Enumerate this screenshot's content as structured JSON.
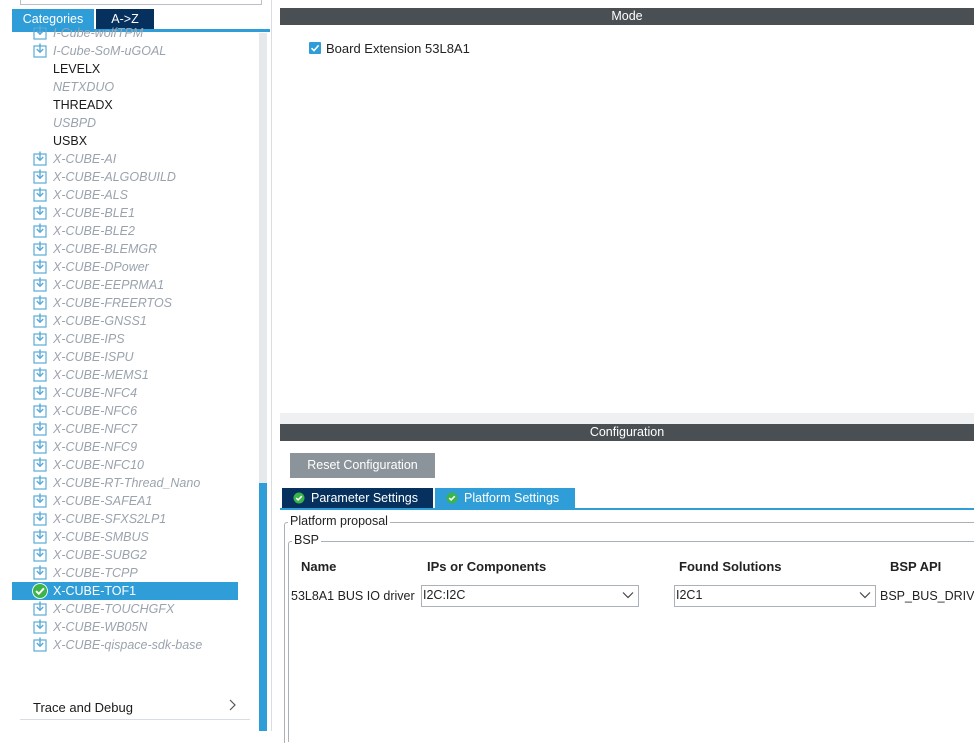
{
  "left_panel": {
    "tabs": {
      "categories": "Categories",
      "az": "A->Z"
    },
    "items": [
      {
        "label": "I-Cube-wolfTPM",
        "style": "grey",
        "icon": "download-icon"
      },
      {
        "label": "I-Cube-SoM-uGOAL",
        "style": "grey",
        "icon": "download-icon"
      },
      {
        "label": "LEVELX",
        "style": "dark",
        "icon": ""
      },
      {
        "label": "NETXDUO",
        "style": "greytxt",
        "icon": ""
      },
      {
        "label": "THREADX",
        "style": "dark",
        "icon": ""
      },
      {
        "label": "USBPD",
        "style": "greytxt",
        "icon": ""
      },
      {
        "label": "USBX",
        "style": "dark",
        "icon": ""
      },
      {
        "label": "X-CUBE-AI",
        "style": "grey",
        "icon": "download-icon"
      },
      {
        "label": "X-CUBE-ALGOBUILD",
        "style": "grey",
        "icon": "download-icon"
      },
      {
        "label": "X-CUBE-ALS",
        "style": "grey",
        "icon": "download-icon"
      },
      {
        "label": "X-CUBE-BLE1",
        "style": "grey",
        "icon": "download-icon"
      },
      {
        "label": "X-CUBE-BLE2",
        "style": "grey",
        "icon": "download-icon"
      },
      {
        "label": "X-CUBE-BLEMGR",
        "style": "grey",
        "icon": "download-icon"
      },
      {
        "label": "X-CUBE-DPower",
        "style": "grey",
        "icon": "download-icon"
      },
      {
        "label": "X-CUBE-EEPRMA1",
        "style": "grey",
        "icon": "download-icon"
      },
      {
        "label": "X-CUBE-FREERTOS",
        "style": "grey",
        "icon": "download-icon"
      },
      {
        "label": "X-CUBE-GNSS1",
        "style": "grey",
        "icon": "download-icon"
      },
      {
        "label": "X-CUBE-IPS",
        "style": "grey",
        "icon": "download-icon"
      },
      {
        "label": "X-CUBE-ISPU",
        "style": "grey",
        "icon": "download-icon"
      },
      {
        "label": "X-CUBE-MEMS1",
        "style": "grey",
        "icon": "download-icon"
      },
      {
        "label": "X-CUBE-NFC4",
        "style": "grey",
        "icon": "download-icon"
      },
      {
        "label": "X-CUBE-NFC6",
        "style": "grey",
        "icon": "download-icon"
      },
      {
        "label": "X-CUBE-NFC7",
        "style": "grey",
        "icon": "download-icon"
      },
      {
        "label": "X-CUBE-NFC9",
        "style": "grey",
        "icon": "download-icon"
      },
      {
        "label": "X-CUBE-NFC10",
        "style": "grey",
        "icon": "download-icon"
      },
      {
        "label": "X-CUBE-RT-Thread_Nano",
        "style": "grey",
        "icon": "download-icon"
      },
      {
        "label": "X-CUBE-SAFEA1",
        "style": "grey",
        "icon": "download-icon"
      },
      {
        "label": "X-CUBE-SFXS2LP1",
        "style": "grey",
        "icon": "download-icon"
      },
      {
        "label": "X-CUBE-SMBUS",
        "style": "grey",
        "icon": "download-icon"
      },
      {
        "label": "X-CUBE-SUBG2",
        "style": "grey",
        "icon": "download-icon"
      },
      {
        "label": "X-CUBE-TCPP",
        "style": "grey",
        "icon": "download-icon"
      },
      {
        "label": "X-CUBE-TOF1",
        "style": "sel",
        "icon": "check-circle-icon"
      },
      {
        "label": "X-CUBE-TOUCHGFX",
        "style": "grey",
        "icon": "download-icon"
      },
      {
        "label": "X-CUBE-WB05N",
        "style": "grey",
        "icon": "download-icon"
      },
      {
        "label": "X-CUBE-qispace-sdk-base",
        "style": "grey",
        "icon": "download-icon"
      }
    ],
    "trace_debug": "Trace and Debug"
  },
  "mode": {
    "title": "Mode",
    "board_extension_label": "Board Extension 53L8A1",
    "board_extension_checked": true
  },
  "configuration": {
    "title": "Configuration",
    "reset_button": "Reset Configuration",
    "tabs": {
      "parameter": "Parameter Settings",
      "platform": "Platform Settings"
    },
    "platform_proposal_label": "Platform proposal",
    "bsp_label": "BSP",
    "headers": {
      "name": "Name",
      "ips": "IPs or Components",
      "found": "Found Solutions",
      "api": "BSP API"
    },
    "row": {
      "name": "53L8A1 BUS IO driver",
      "ips_value": "I2C:I2C",
      "found_value": "I2C1",
      "api": "BSP_BUS_DRIV"
    }
  },
  "colors": {
    "accent": "#2f9ed8",
    "dark_tab": "#06315f",
    "bar": "#4a4f54",
    "button": "#8c949b"
  }
}
